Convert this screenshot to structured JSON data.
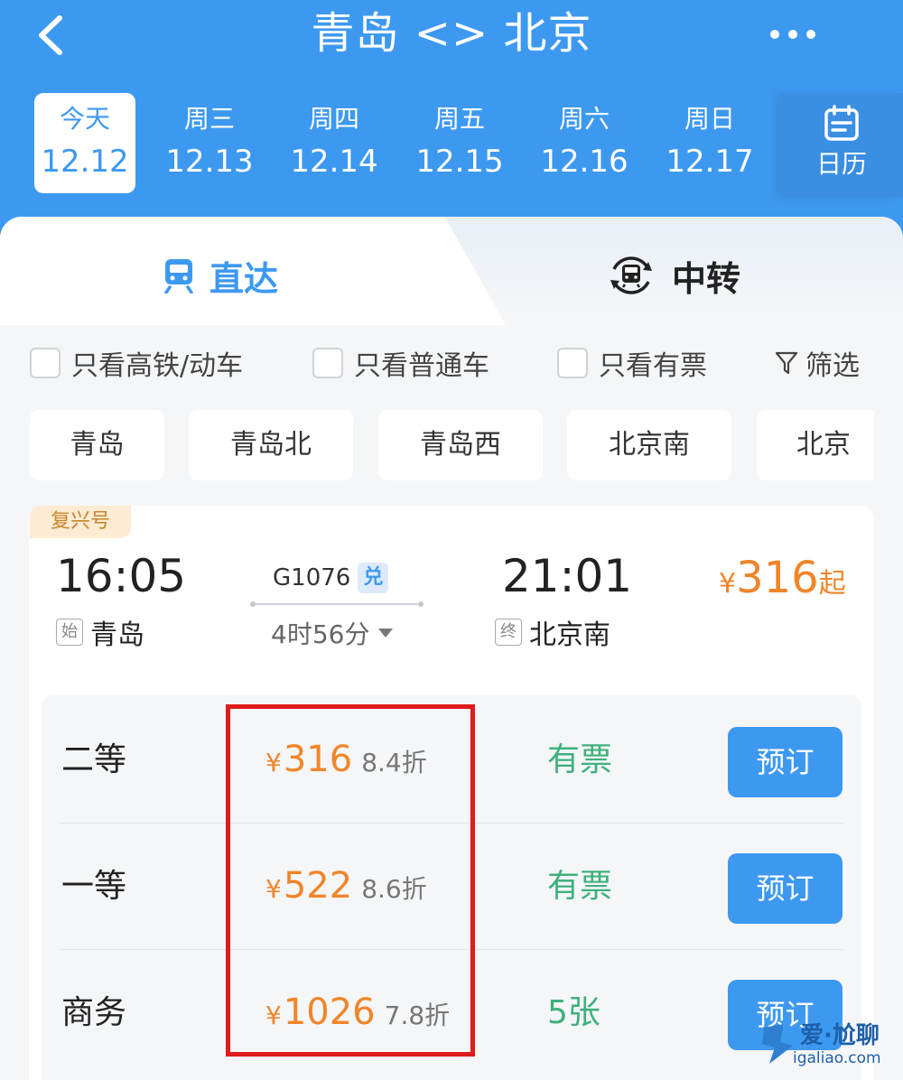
{
  "header": {
    "title": "青岛 <> 北京",
    "back_icon": "chevron-left-icon",
    "more_icon": "more-dots-icon",
    "background": "#3d99f0"
  },
  "dates": [
    {
      "weekday": "今天",
      "date": "12.12",
      "selected": true
    },
    {
      "weekday": "周三",
      "date": "12.13"
    },
    {
      "weekday": "周四",
      "date": "12.14"
    },
    {
      "weekday": "周五",
      "date": "12.15"
    },
    {
      "weekday": "周六",
      "date": "12.16"
    },
    {
      "weekday": "周日",
      "date": "12.17"
    }
  ],
  "calendar": {
    "label": "日历",
    "icon": "calendar-icon"
  },
  "tabs": {
    "direct": {
      "label": "直达",
      "icon": "train-icon",
      "active": true
    },
    "transfer": {
      "label": "中转",
      "icon": "transfer-train-icon"
    }
  },
  "filters": {
    "high_speed": "只看高铁/动车",
    "regular": "只看普通车",
    "available": "只看有票",
    "screen": "筛选"
  },
  "stations": [
    "青岛",
    "青岛北",
    "青岛西",
    "北京南",
    "北京"
  ],
  "train": {
    "badge": "复兴号",
    "departure_time": "16:05",
    "departure_tag": "始",
    "departure_station": "青岛",
    "train_number": "G1076",
    "exchange_tag": "兑",
    "duration": "4时56分",
    "arrival_time": "21:01",
    "arrival_tag": "终",
    "arrival_station": "北京南",
    "min_price_symbol": "¥",
    "min_price": "316",
    "min_price_suffix": "起"
  },
  "seats": [
    {
      "name": "二等",
      "currency": "¥",
      "price": "316",
      "discount": "8.4折",
      "availability": "有票",
      "action": "预订"
    },
    {
      "name": "一等",
      "currency": "¥",
      "price": "522",
      "discount": "8.6折",
      "availability": "有票",
      "action": "预订"
    },
    {
      "name": "商务",
      "currency": "¥",
      "price": "1026",
      "discount": "7.8折",
      "availability": "5张",
      "action": "预订"
    }
  ],
  "watermark": {
    "title": "爱·尬聊",
    "url": "igaliao.com"
  },
  "colors": {
    "accent": "#3d99f0",
    "price": "#f0852a",
    "available": "#3fb07c",
    "highlight": "#e01b1b"
  }
}
